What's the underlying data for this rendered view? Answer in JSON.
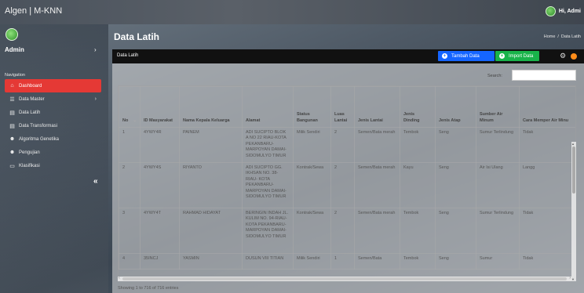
{
  "app": {
    "title": "Algen | M-KNN"
  },
  "topbar": {
    "greeting": "Hi, Admi"
  },
  "sidebar": {
    "user": "Admin",
    "nav_heading": "Navigation",
    "items": [
      {
        "label": "Dashboard",
        "icon": "home-icon",
        "active": true
      },
      {
        "label": "Data Master",
        "icon": "list-icon",
        "has_submenu": true
      },
      {
        "label": "Data Latih",
        "icon": "file-icon"
      },
      {
        "label": "Data Transformasi",
        "icon": "file-icon"
      },
      {
        "label": "Algoritma Genetika",
        "icon": "users-icon"
      },
      {
        "label": "Pengujian",
        "icon": "users-icon"
      },
      {
        "label": "Klasifikasi",
        "icon": "monitor-icon"
      }
    ],
    "collapse_symbol": "«"
  },
  "page": {
    "title": "Data Latih",
    "breadcrumb": {
      "home": "Home",
      "sep": "/",
      "current": "Data Latih"
    }
  },
  "card": {
    "title": "Data Latih",
    "add_button": "Tambah Data",
    "import_button": "Import Data",
    "search_label": "Search:",
    "search_value": ""
  },
  "table": {
    "headers": {
      "no": "No",
      "id": "ID Masyarakat",
      "nama": "Nama Kepala Keluarga",
      "alamat": "Alamat",
      "status": "Status Bangunan",
      "luas": "Luas Lantai",
      "lantai": "Jenis Lantai",
      "dinding": "Jenis Dinding",
      "atap": "Jenis Atap",
      "air": "Sumber Air Minum",
      "cara": "Cara Memper Air Minu"
    },
    "rows": [
      {
        "no": "1",
        "id": "4YWY4R",
        "nama": "PAINEM",
        "alamat": "ADI SUCIPTO BLOK A NO 22 RIAU-KOTA PEKANBARU-MARPOYAN DAMAI-SIDOMULYO TIMUR",
        "status": "Milik Sendiri",
        "luas": "2",
        "lantai": "Semen/Bata merah",
        "dinding": "Tembok",
        "atap": "Seng",
        "air": "Sumur Terlindung",
        "cara": "Tidak"
      },
      {
        "no": "2",
        "id": "4YWY4S",
        "nama": "RIYANTO",
        "alamat": "ADI SUCIPTO GG. IKHSAN NO. 38-RIAU- KOTA PEKANBARU-MARPOYAN DAMAI-SIDOMULYO TIMUR",
        "status": "Kontrak/Sewa",
        "luas": "2",
        "lantai": "Semen/Bata merah",
        "dinding": "Kayu",
        "atap": "Seng",
        "air": "Air Isi Ulang",
        "cara": "Langg"
      },
      {
        "no": "3",
        "id": "4YWY4T",
        "nama": "RAHMAD HIDAYAT",
        "alamat": "BERINGIN INDAH JL. KULIM NO. 94-RIAU- KOTA PEKANBARU-MARPOYAN DAMAI-SIDOMULYO TIMUR",
        "status": "Kontrak/Sewa",
        "luas": "2",
        "lantai": "Semen/Bata merah",
        "dinding": "Tembok",
        "atap": "Seng",
        "air": "Sumur Terlindung",
        "cara": "Tidak"
      },
      {
        "no": "4",
        "id": "35INCJ",
        "nama": "YASMIN",
        "alamat": "DUSUN VIII TITIAN",
        "status": "Milik Sendiri",
        "luas": "1",
        "lantai": "Semen/Bata",
        "dinding": "Tembok",
        "atap": "Seng",
        "air": "Sumur",
        "cara": "Tidak"
      }
    ]
  },
  "footer": {
    "info": "Showing 1 to 716 of 716 entries"
  },
  "colors": {
    "accent_red": "#e53935",
    "add_blue": "#1565ff",
    "import_green": "#19b34a",
    "header_bar": "#111111",
    "notify_orange": "#ff8c1a"
  }
}
